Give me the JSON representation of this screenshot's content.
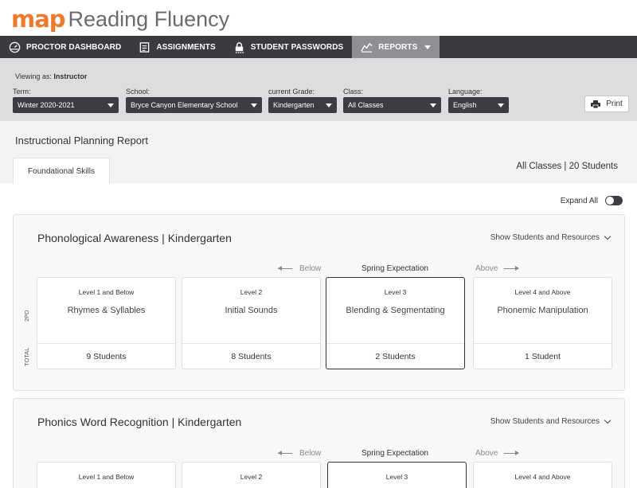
{
  "app": {
    "logo_map": "map",
    "logo_title": "Reading Fluency"
  },
  "nav": {
    "items": [
      {
        "label": "PROCTOR DASHBOARD",
        "icon": "dashboard-icon"
      },
      {
        "label": "ASSIGNMENTS",
        "icon": "assignments-icon"
      },
      {
        "label": "STUDENT PASSWORDS",
        "icon": "lock-icon"
      },
      {
        "label": "REPORTS",
        "icon": "reports-icon",
        "active": true
      }
    ]
  },
  "filters": {
    "viewing_prefix": "Viewing as:",
    "viewing_role": "Instructor",
    "term": {
      "label": "Term:",
      "value": "Winter 2020-2021"
    },
    "school": {
      "label": "School:",
      "value": "Bryce Canyon Elementary School"
    },
    "grade": {
      "label": "current Grade:",
      "value": "Kindergarten"
    },
    "class": {
      "label": "Class:",
      "value": "All Classes"
    },
    "language": {
      "label": "Language:",
      "value": "English"
    },
    "print_label": "Print"
  },
  "report": {
    "title": "Instructional Planning Report",
    "tab_label": "Foundational Skills",
    "summary": "All Classes | 20 Students",
    "expand_all": "Expand All"
  },
  "sections": [
    {
      "title": "Phonological Awareness | Kindergarten",
      "show_link": "Show Students and Resources",
      "below": "Below",
      "expectation": "Spring Expectation",
      "above": "Above",
      "side_top": "2PD",
      "side_bottom": "TOTAL",
      "cards": [
        {
          "level": "Level 1 and Below",
          "skill": "Rhymes & Syllables",
          "count": "9 Students"
        },
        {
          "level": "Level 2",
          "skill": "Initial Sounds",
          "count": "8 Students"
        },
        {
          "level": "Level 3",
          "skill": "Blending & Segmentating",
          "count": "2 Students"
        },
        {
          "level": "Level 4 and Above",
          "skill": "Phonemic Manipulation",
          "count": "1 Student"
        }
      ]
    },
    {
      "title": "Phonics Word Recognition | Kindergarten",
      "show_link": "Show Students and Resources",
      "below": "Below",
      "expectation": "Spring Expectation",
      "above": "Above",
      "cards": [
        {
          "level": "Level 1 and Below"
        },
        {
          "level": "Level 2"
        },
        {
          "level": "Level 3"
        },
        {
          "level": "Level 4 and Above"
        }
      ]
    }
  ],
  "colors": {
    "brand_orange": "#ee7a2d",
    "nav_dark": "#393b3e",
    "nav_active": "#8e9094"
  }
}
